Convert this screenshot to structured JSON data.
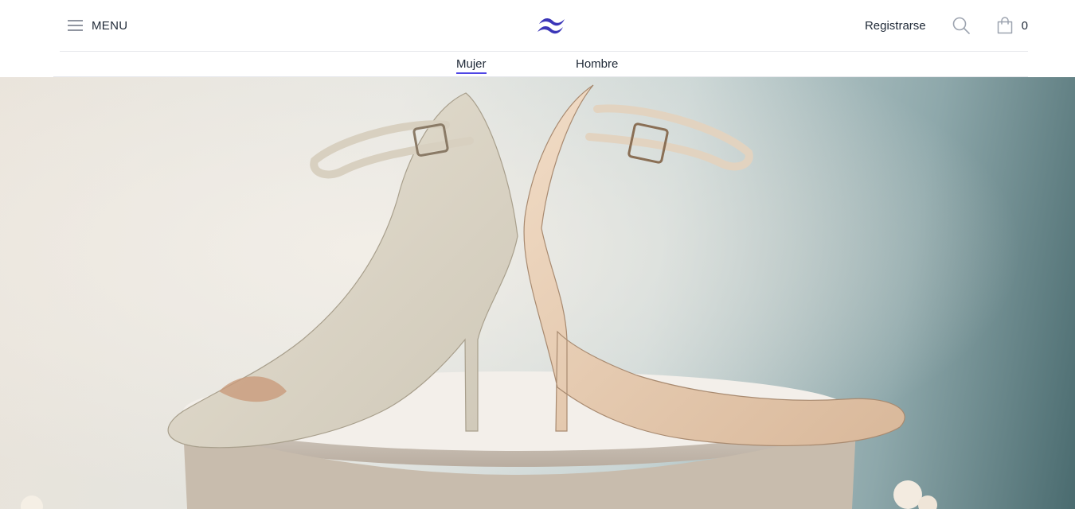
{
  "header": {
    "menu_label": "MENU",
    "menu_icon": "hamburger-icon",
    "logo_icon": "tailwind-wave-logo",
    "register_label": "Registrarse",
    "search_icon": "search-icon",
    "cart_icon": "shopping-bag-icon",
    "cart_count": "0"
  },
  "categories": [
    {
      "label": "Mujer",
      "active": true
    },
    {
      "label": "Hombre",
      "active": false
    }
  ],
  "colors": {
    "accent": "#4f46e5",
    "text": "#1f2937",
    "logo": "#312e81",
    "border": "#e5e7eb"
  },
  "hero": {
    "image": "Pair of cream high-heel pumps with ankle straps and ornate embossed patterns on a round pedestal"
  }
}
